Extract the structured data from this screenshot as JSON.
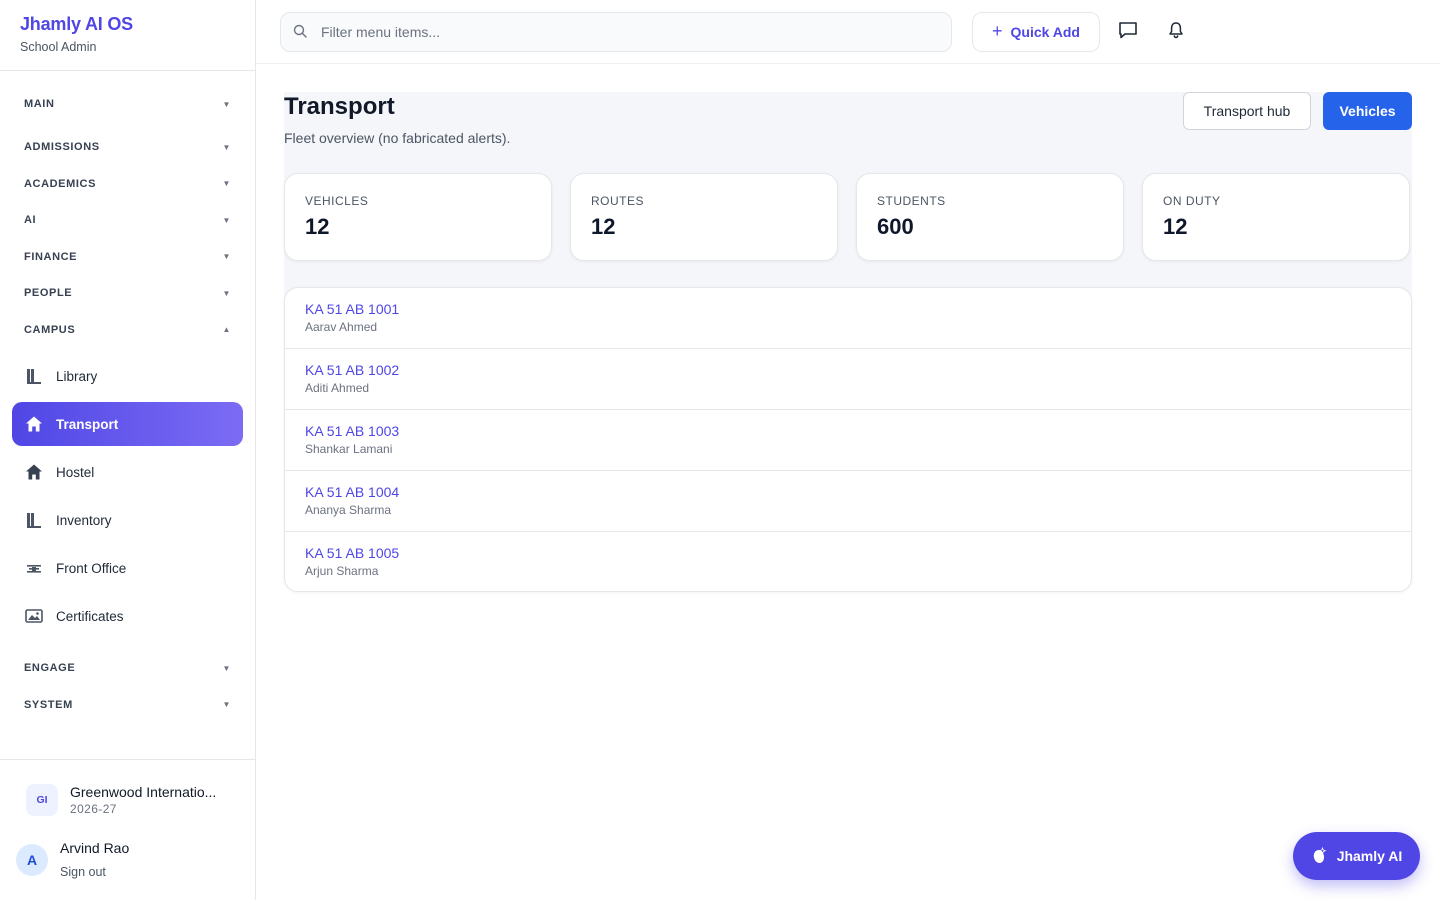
{
  "brand": {
    "title": "Jhamly AI OS",
    "subtitle": "School Admin"
  },
  "nav": {
    "sections": {
      "main": "MAIN",
      "admissions": "ADMISSIONS",
      "academics": "ACADEMICS",
      "ai": "AI",
      "finance": "FINANCE",
      "people": "PEOPLE",
      "campus": "CAMPUS",
      "engage": "ENGAGE",
      "system": "SYSTEM"
    },
    "campus_items": [
      {
        "label": "Library",
        "icon": "library-icon"
      },
      {
        "label": "Transport",
        "icon": "home-icon",
        "active": true
      },
      {
        "label": "Hostel",
        "icon": "home-icon"
      },
      {
        "label": "Inventory",
        "icon": "library-icon"
      },
      {
        "label": "Front Office",
        "icon": "front-office-icon"
      },
      {
        "label": "Certificates",
        "icon": "certificate-icon"
      }
    ]
  },
  "footer": {
    "school_initials": "GI",
    "school_name": "Greenwood Internatio...",
    "school_year": "2026-27",
    "user_initial": "A",
    "user_name": "Arvind Rao",
    "signout": "Sign out"
  },
  "topbar": {
    "search_placeholder": "Filter menu items...",
    "quick_add": "Quick Add"
  },
  "page": {
    "title": "Transport",
    "subtitle": "Fleet overview (no fabricated alerts).",
    "hub_button": "Transport hub",
    "vehicles_button": "Vehicles"
  },
  "stats": [
    {
      "label": "VEHICLES",
      "value": "12"
    },
    {
      "label": "ROUTES",
      "value": "12"
    },
    {
      "label": "STUDENTS",
      "value": "600"
    },
    {
      "label": "ON DUTY",
      "value": "12"
    }
  ],
  "vehicles": [
    {
      "plate": "KA 51 AB 1001",
      "driver": "Aarav Ahmed"
    },
    {
      "plate": "KA 51 AB 1002",
      "driver": "Aditi Ahmed"
    },
    {
      "plate": "KA 51 AB 1003",
      "driver": "Shankar Lamani"
    },
    {
      "plate": "KA 51 AB 1004",
      "driver": "Ananya Sharma"
    },
    {
      "plate": "KA 51 AB 1005",
      "driver": "Arjun Sharma"
    }
  ],
  "assistant": {
    "label": "Jhamly AI"
  },
  "colors": {
    "accent": "#4f46e5",
    "primary_button": "#2563eb"
  }
}
